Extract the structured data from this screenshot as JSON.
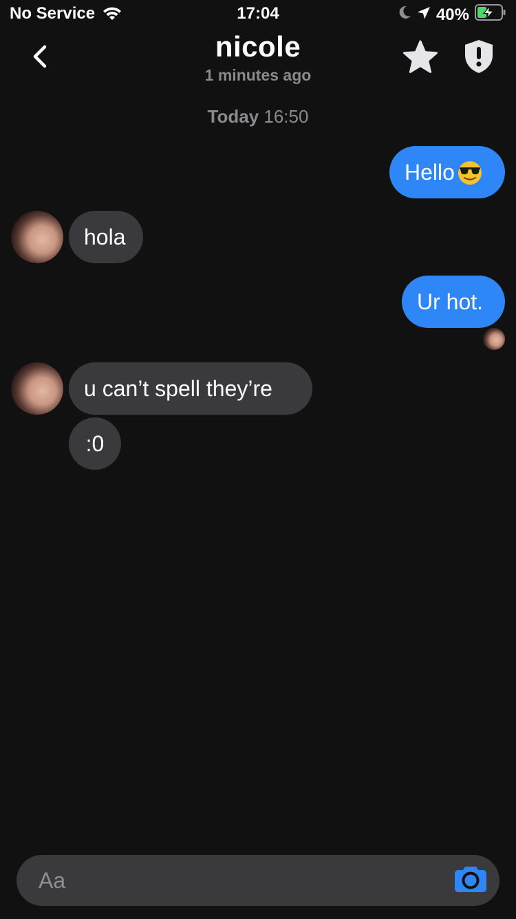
{
  "status_bar": {
    "carrier": "No Service",
    "time": "17:04",
    "battery_percent": "40%",
    "battery_level": 0.4,
    "icons": [
      "wifi-icon",
      "moon-icon",
      "location-arrow-icon",
      "battery-charging-icon"
    ]
  },
  "header": {
    "name": "nicole",
    "last_seen": "1 minutes ago",
    "icons": [
      "back-chevron-icon",
      "star-icon",
      "shield-alert-icon"
    ]
  },
  "chat": {
    "separator": {
      "day": "Today",
      "time": "16:50"
    },
    "messages": [
      {
        "direction": "outgoing",
        "text": "Hello",
        "emoji": "smiling-face-with-sunglasses-icon"
      },
      {
        "direction": "incoming",
        "text": "hola"
      },
      {
        "direction": "outgoing",
        "text": "Ur hot."
      },
      {
        "direction": "incoming",
        "text": "u can’t spell they’re"
      },
      {
        "direction": "incoming",
        "text": ":0"
      }
    ]
  },
  "composer": {
    "placeholder": "Aa",
    "icons": [
      "camera-icon"
    ]
  },
  "colors": {
    "background": "#111112",
    "outgoing_bubble": "#2f86f6",
    "incoming_bubble": "#3a3a3c",
    "secondary_text": "#8a8a8e",
    "camera_accent": "#2f86f6",
    "battery_charging": "#4cd964"
  }
}
